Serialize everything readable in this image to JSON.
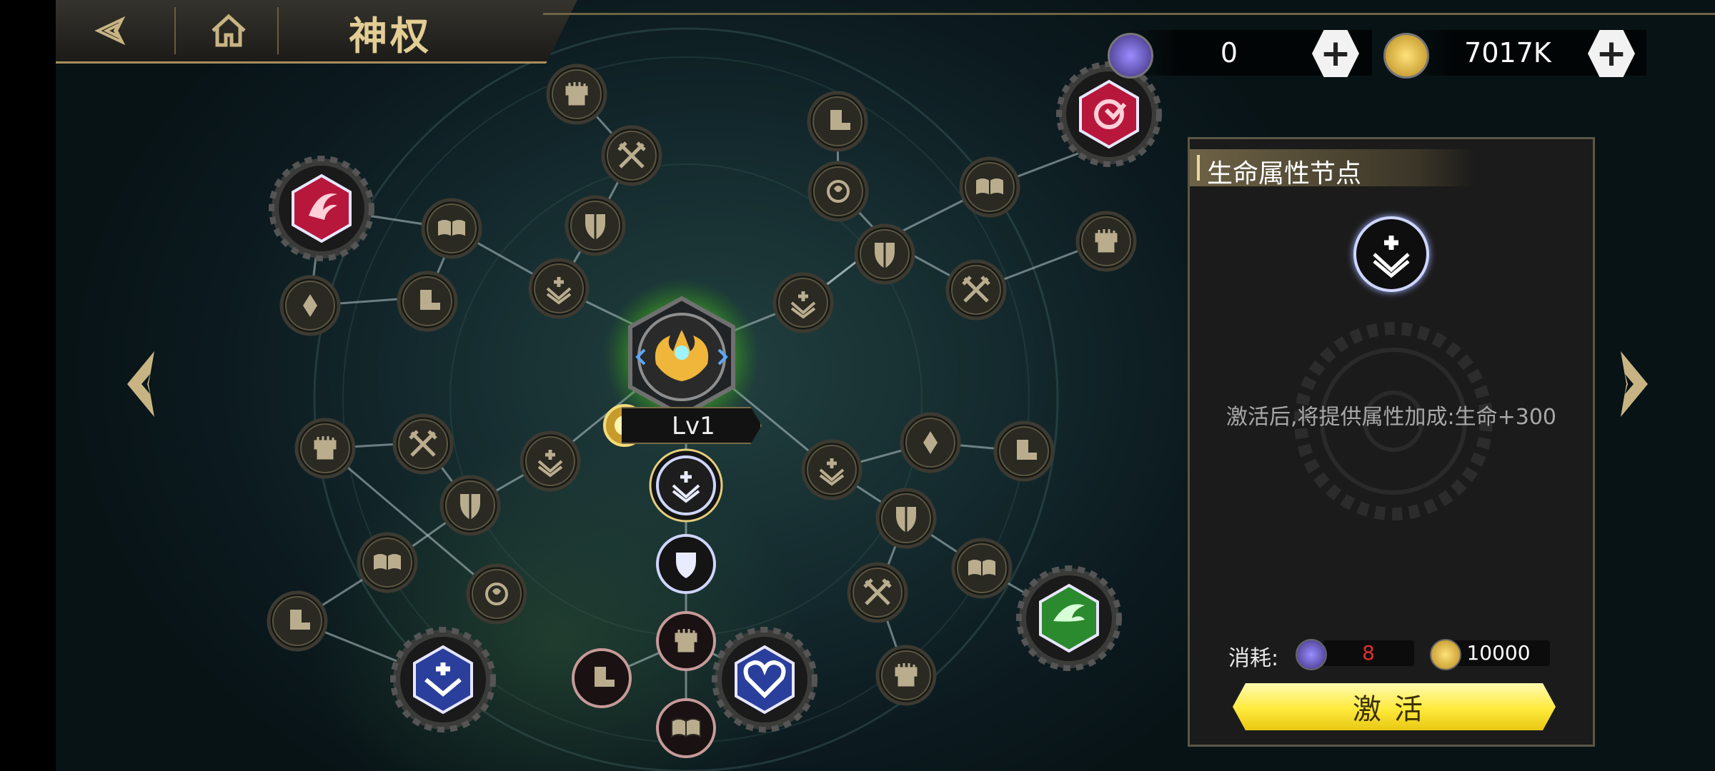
{
  "header": {
    "title": "神权",
    "back_icon": "back-arrow-icon",
    "home_icon": "home-icon"
  },
  "currencies": [
    {
      "name": "crystal",
      "icon": "crystal-icon",
      "value": "0"
    },
    {
      "name": "gold",
      "icon": "gold-coin-icon",
      "value": "7017K"
    }
  ],
  "tree": {
    "center_level": "Lv1",
    "center_icon": "divine-crest-icon",
    "node_icons": [
      "fist-icon",
      "swords-icon",
      "shield-icon",
      "book-icon",
      "boot-icon",
      "heart-plus-icon",
      "rose-icon",
      "diamond-icon"
    ],
    "key_nodes": [
      "red-wing-emblem",
      "red-return-emblem",
      "green-wing-emblem",
      "blue-plus-emblem",
      "blue-heart-emblem"
    ],
    "colors": {
      "accent_gold": "#c8b483",
      "active_glow": "#7cff4a",
      "selected_ring": "#cfd6ff"
    }
  },
  "panel": {
    "title": "生命属性节点",
    "description": "激活后,将提供属性加成:生命+300",
    "cost_label": "消耗:",
    "cost_crystal": "8",
    "cost_gold": "10000",
    "activate_label": "激活"
  }
}
